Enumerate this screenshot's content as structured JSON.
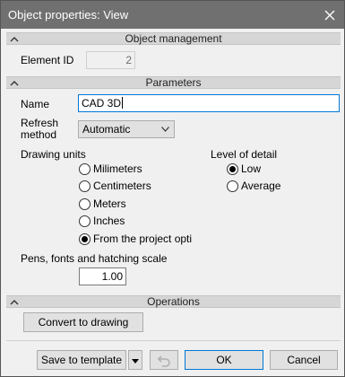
{
  "window": {
    "title": "Object properties: View"
  },
  "icons": {
    "close": "close-icon",
    "collapse": "chevron-up-icon",
    "dropdown": "chevron-down-icon",
    "undo": "undo-icon"
  },
  "sections": {
    "object_management": "Object management",
    "parameters": "Parameters",
    "operations": "Operations"
  },
  "object_management": {
    "element_id_label": "Element ID",
    "element_id_value": "2"
  },
  "parameters": {
    "name_label": "Name",
    "name_value": "CAD 3D",
    "refresh_label_line1": "Refresh",
    "refresh_label_line2": "method",
    "refresh_value": "Automatic",
    "drawing_units_label": "Drawing units",
    "units": [
      {
        "label": "Milimeters",
        "selected": false
      },
      {
        "label": "Centimeters",
        "selected": false
      },
      {
        "label": "Meters",
        "selected": false
      },
      {
        "label": "Inches",
        "selected": false
      },
      {
        "label": "From the project options",
        "selected": true
      }
    ],
    "level_of_detail_label": "Level of detail",
    "detail": [
      {
        "label": "Low",
        "selected": true
      },
      {
        "label": "Average",
        "selected": false
      }
    ],
    "scale_label": "Pens, fonts and hatching scale",
    "scale_value": "1.00"
  },
  "operations": {
    "convert_label": "Convert to drawing"
  },
  "footer": {
    "save_template_label": "Save to template",
    "ok_label": "OK",
    "cancel_label": "Cancel"
  },
  "colors": {
    "titlebar": "#707070",
    "focus": "#0078d7",
    "section": "#d6d6d6"
  }
}
